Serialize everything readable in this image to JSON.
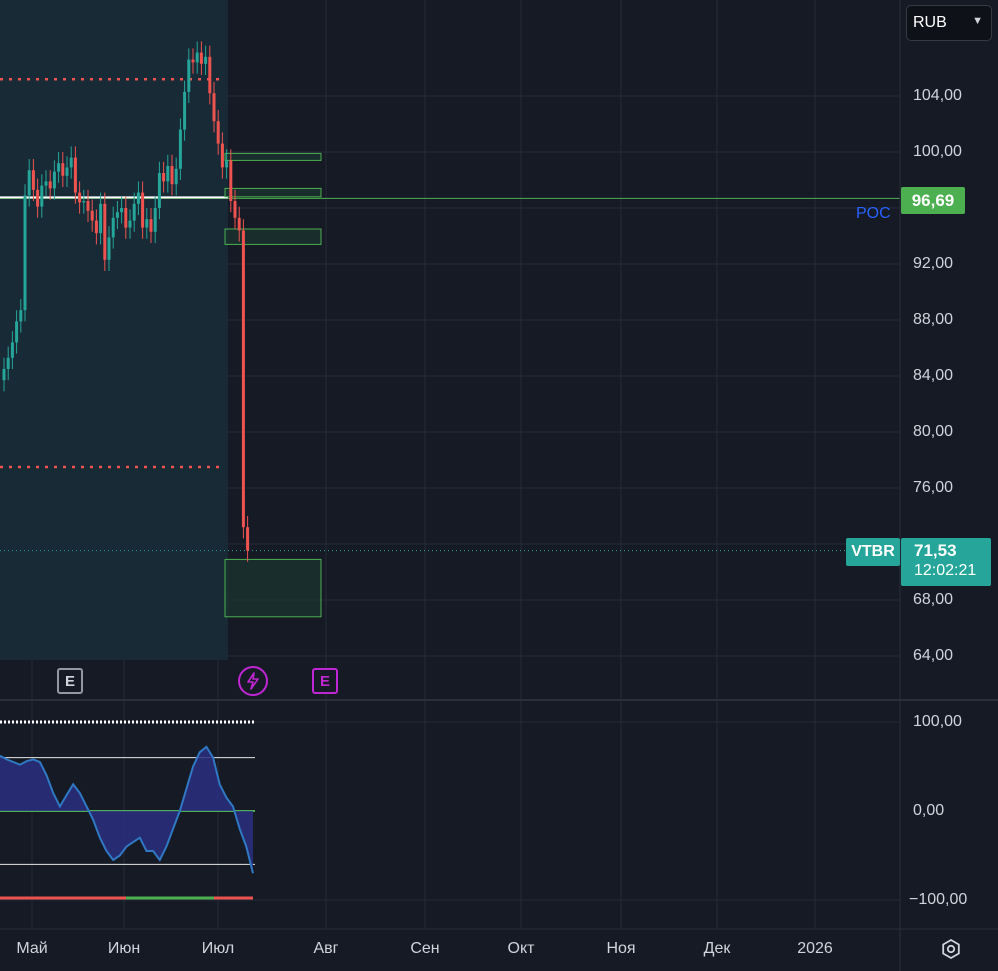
{
  "currency_select": {
    "value": "RUB"
  },
  "price_axis": {
    "ticks": [
      "104,00",
      "100,00",
      "92,00",
      "88,00",
      "84,00",
      "80,00",
      "76,00",
      "68,00",
      "64,00"
    ],
    "tick_values": [
      104,
      100,
      92,
      88,
      84,
      80,
      76,
      68,
      64
    ]
  },
  "indicator_axis": {
    "ticks": [
      "100,00",
      "0,00",
      "−100,00"
    ],
    "tick_values": [
      100,
      0,
      -100
    ]
  },
  "time_axis": {
    "labels": [
      "Май",
      "Июн",
      "Июл",
      "Авг",
      "Сен",
      "Окт",
      "Ноя",
      "Дек",
      "2026"
    ]
  },
  "poc": {
    "label": "POC",
    "value": "96,69",
    "price": 96.69
  },
  "last_price": {
    "symbol": "VTBR",
    "value": "71,53",
    "countdown": "12:02:21",
    "price": 71.53
  },
  "events": {
    "earnings_label": "E",
    "earnings_label_2": "E",
    "dividend_icon": "lightning-icon"
  },
  "colors": {
    "up": "#26a69a",
    "down": "#ef5350",
    "poc": "#4caf50",
    "poc_text": "#2962ff",
    "last": "#26a69a",
    "event_accent": "#c026d3",
    "grid": "#262b38",
    "zone_fill": "#1b3a32",
    "zone_border": "#4caf50"
  },
  "chart_data": {
    "type": "candlestick",
    "start_date": "2025-04-21",
    "bar_interval": "1 trading day",
    "level_lines": {
      "upper_dotted": 105.2,
      "lower_dotted": 77.5
    },
    "zones": [
      {
        "from_price": 99.4,
        "to_price": 99.9
      },
      {
        "from_price": 96.8,
        "to_price": 97.4
      },
      {
        "from_price": 93.4,
        "to_price": 94.5
      },
      {
        "from_price": 66.8,
        "to_price": 70.9
      }
    ],
    "closes": [
      84.5,
      85.3,
      86.4,
      87.9,
      88.7,
      96.9,
      98.7,
      97.3,
      96.1,
      97.6,
      97.9,
      97.4,
      98.6,
      99.2,
      98.3,
      98.9,
      99.6,
      97.1,
      96.4,
      96.5,
      95.8,
      95.1,
      94.2,
      96.3,
      92.3,
      93.9,
      95.3,
      95.7,
      96.0,
      94.6,
      95.1,
      96.3,
      97.1,
      94.6,
      95.2,
      94.3,
      96.0,
      98.5,
      97.9,
      99.0,
      97.7,
      98.8,
      101.6,
      104.3,
      106.6,
      106.4,
      107.1,
      106.3,
      106.8,
      104.2,
      102.2,
      100.6,
      98.9,
      99.4,
      96.5,
      95.3,
      94.4,
      73.2,
      71.53
    ]
  },
  "oscillator": {
    "upper_line": 60,
    "lower_line": -60,
    "zero_line": 0,
    "series_blue": [
      62,
      58,
      55,
      52,
      56,
      58,
      55,
      40,
      20,
      5,
      18,
      30,
      20,
      5,
      -10,
      -30,
      -45,
      -55,
      -50,
      -40,
      -35,
      -30,
      -45,
      -45,
      -55,
      -40,
      -20,
      0,
      25,
      50,
      66,
      72,
      60,
      30,
      15,
      5,
      -20,
      -40,
      -70
    ]
  }
}
